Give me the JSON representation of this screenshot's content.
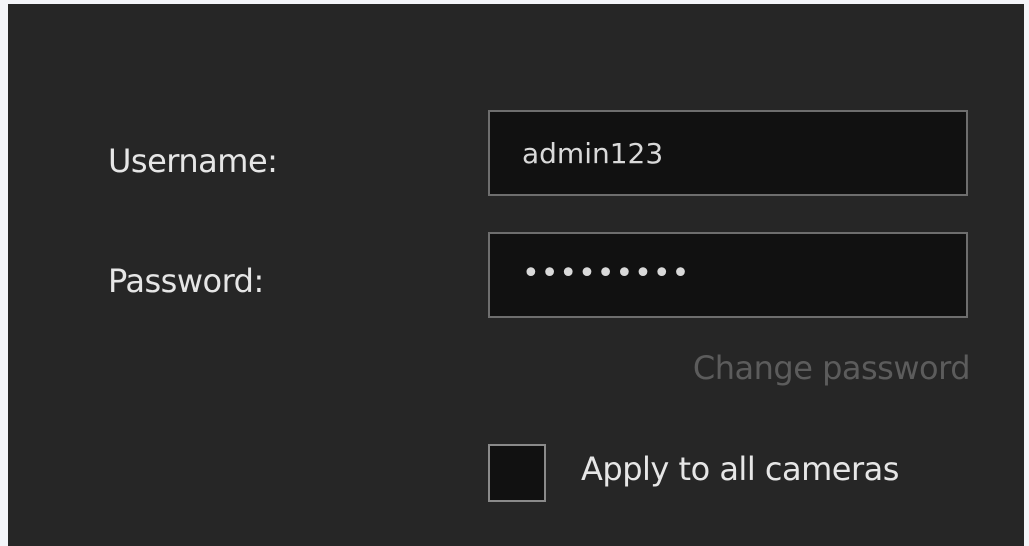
{
  "form": {
    "username_label": "Username:",
    "username_value": "admin123",
    "password_label": "Password:",
    "password_value": "•••••••••",
    "change_password_link": "Change password",
    "apply_all_label": "Apply to all cameras",
    "apply_all_checked": false
  },
  "colors": {
    "dialog_background": "#262626",
    "field_background": "#111111",
    "field_border": "#6e6e6e",
    "label_text": "#e6e6e6",
    "disabled_link": "#5c5c5c"
  }
}
